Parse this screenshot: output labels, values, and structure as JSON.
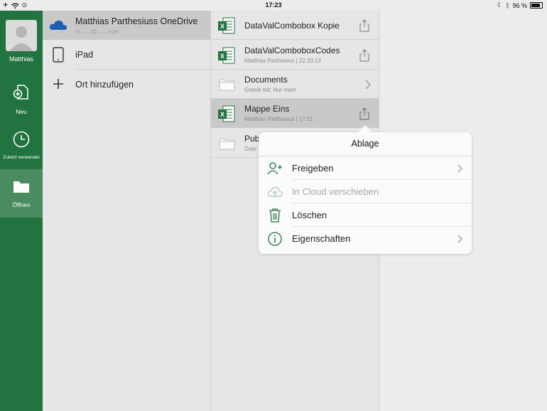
{
  "status_bar": {
    "time": "17:23",
    "battery": "96 %"
  },
  "rail": {
    "user_name": "Matthias",
    "items": [
      {
        "label": "Neu"
      },
      {
        "label": "Zuletzt verwendet"
      },
      {
        "label": "Öffnen"
      }
    ]
  },
  "places": [
    {
      "title": "Matthias Parthesiuss OneDrive",
      "subtitle": "m...  ...@...  ...com"
    },
    {
      "title": "iPad"
    },
    {
      "title": "Ort hinzufügen"
    }
  ],
  "files": [
    {
      "title": "DataValCombobox Kopie",
      "subtitle": ""
    },
    {
      "title": "DataValComboboxCodes",
      "subtitle": "Matthias Parthesius | 22.10.13"
    },
    {
      "title": "Documents",
      "subtitle": "Geteilt mit: Nur mich"
    },
    {
      "title": "Mappe Eins",
      "subtitle": "Matthias Parthesius | 17:21"
    },
    {
      "title": "Pub",
      "subtitle": "Gete"
    }
  ],
  "popover": {
    "title": "Ablage",
    "items": [
      {
        "label": "Freigeben"
      },
      {
        "label": "In Cloud verschieben"
      },
      {
        "label": "Löschen"
      },
      {
        "label": "Eigenschaften"
      }
    ]
  },
  "colors": {
    "accent": "#21733f",
    "rail_active": "#4a8b5f",
    "onedrive_blue": "#1e5fb4"
  }
}
